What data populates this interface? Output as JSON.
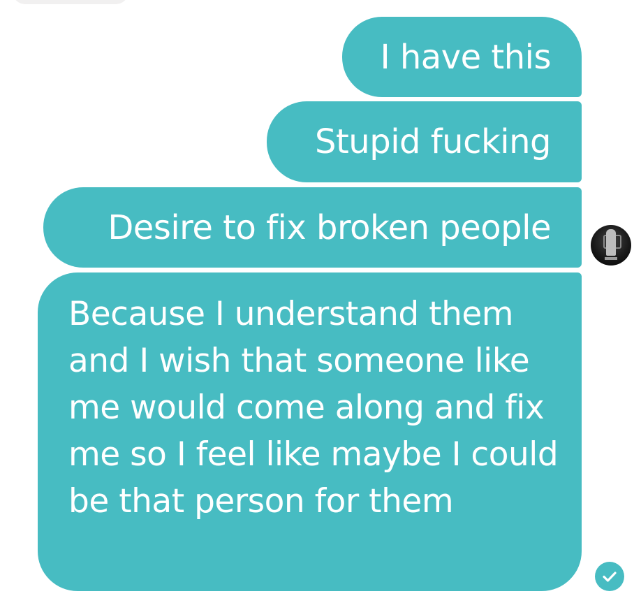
{
  "conversation": {
    "messages": [
      {
        "text": "I have this"
      },
      {
        "text": "Stupid fucking"
      },
      {
        "text": "Desire to fix broken people"
      },
      {
        "text": "Because I understand them and I wish that someone like me would come along and fix me so I feel like maybe I could be that person for them"
      }
    ],
    "bubble_color": "#47bcc2",
    "avatar_icon": "user-avatar-icon",
    "receipt_icon": "seen-check-icon"
  }
}
